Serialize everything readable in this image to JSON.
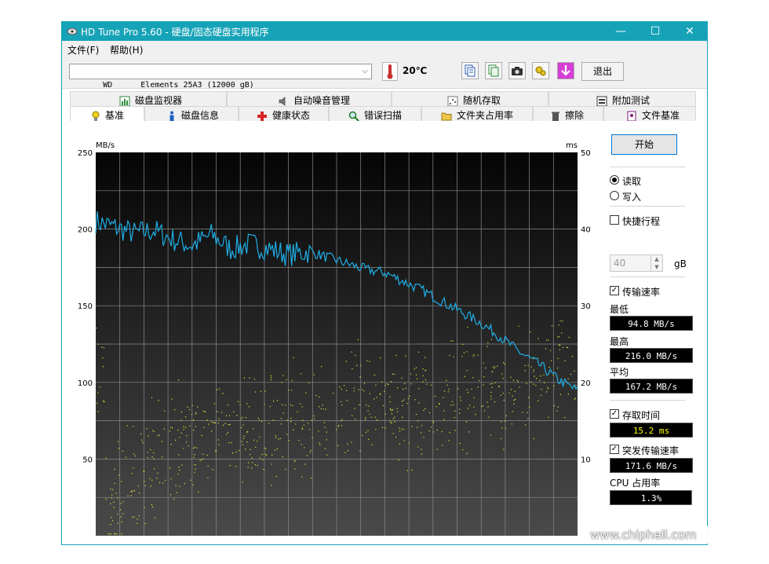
{
  "window": {
    "title": "HD Tune Pro 5.60 - 硬盘/固态硬盘实用程序",
    "controls": {
      "minimize": "—",
      "maximize": "☐",
      "close": "✕"
    }
  },
  "menu": {
    "file": "文件(F)",
    "help": "帮助(H)"
  },
  "toolbar": {
    "drive": "WD      Elements 25A3 (12000 gB)",
    "temperature": "20℃",
    "exit_label": "退出",
    "icons": [
      "copy-text-icon",
      "copy-screen-icon",
      "camera-icon",
      "options-icon",
      "download-icon"
    ]
  },
  "tabs_top": [
    {
      "label": "磁盘监视器",
      "icon": "monitor-chart-icon"
    },
    {
      "label": "自动噪音管理",
      "icon": "speaker-icon"
    },
    {
      "label": "随机存取",
      "icon": "random-access-icon"
    },
    {
      "label": "附加测试",
      "icon": "extra-tests-icon"
    }
  ],
  "tabs_bottom": [
    {
      "label": "基准",
      "icon": "bulb-icon",
      "active": true
    },
    {
      "label": "磁盘信息",
      "icon": "info-icon"
    },
    {
      "label": "健康状态",
      "icon": "health-cross-icon"
    },
    {
      "label": "错误扫描",
      "icon": "magnifier-icon"
    },
    {
      "label": "文件夹占用率",
      "icon": "folder-icon"
    },
    {
      "label": "擦除",
      "icon": "trash-icon"
    },
    {
      "label": "文件基准",
      "icon": "file-benchmark-icon"
    }
  ],
  "panel": {
    "start_label": "开始",
    "read_label": "读取",
    "write_label": "写入",
    "short_stroke_label": "快捷行程",
    "short_stroke_value": "40",
    "short_stroke_unit": "gB",
    "transfer_rate_label": "传输速率",
    "min_label": "最低",
    "min_value": "94.8 MB/s",
    "max_label": "最高",
    "max_value": "216.0 MB/s",
    "avg_label": "平均",
    "avg_value": "167.2 MB/s",
    "access_time_label": "存取时间",
    "access_time_value": "15.2 ms",
    "burst_label": "突发传输速率",
    "burst_value": "171.6 MB/s",
    "cpu_label": "CPU 占用率",
    "cpu_value": "1.3%"
  },
  "chart_data": {
    "type": "line",
    "left_unit": "MB/s",
    "right_unit": "ms",
    "left_ticks": [
      "250",
      "200",
      "150",
      "100",
      "50"
    ],
    "right_ticks": [
      "50",
      "40",
      "30",
      "20",
      "10"
    ],
    "ylim": [
      0,
      250
    ],
    "y2lim": [
      0,
      50
    ],
    "xlim": [
      0,
      100
    ],
    "grid": true,
    "colors": {
      "transfer": "#1eaee6",
      "access": "#e6e63c"
    },
    "series": [
      {
        "x": [
          0,
          4,
          8,
          12,
          16,
          20,
          24,
          28,
          32,
          36,
          40,
          44,
          48,
          52,
          56,
          60,
          64,
          68,
          72,
          76,
          80,
          84,
          88,
          92,
          96,
          100
        ],
        "values": [
          206,
          202,
          198,
          200,
          194,
          190,
          197,
          188,
          191,
          188,
          184,
          186,
          182,
          178,
          174,
          172,
          166,
          160,
          153,
          146,
          139,
          130,
          120,
          112,
          102,
          95
        ]
      },
      {
        "x": [
          2,
          8,
          14,
          20,
          26,
          32,
          38,
          44,
          50,
          56,
          62,
          68,
          74,
          80,
          86,
          92,
          98
        ],
        "values": [
          3,
          8,
          10,
          12,
          13,
          14,
          15,
          15,
          16,
          17,
          18,
          17,
          19,
          19,
          18,
          20,
          20
        ]
      }
    ]
  },
  "watermark": {
    "text": "www.chiphell.com"
  }
}
